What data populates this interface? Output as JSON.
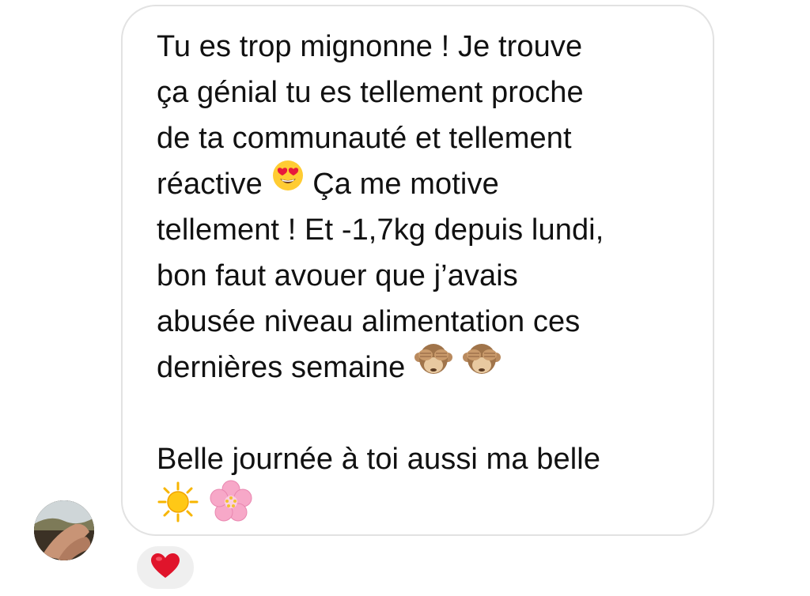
{
  "message": {
    "lines": [
      "Tu es trop mignonne ! Je trouve",
      "ça génial tu es tellement proche",
      "de ta communauté et tellement",
      "réactive",
      "Ça me motive",
      "tellement ! Et -1,7kg depuis lundi,",
      "bon faut avouer que j’avais",
      "abusée niveau alimentation ces",
      "dernières semaine",
      "Belle journée à toi aussi ma belle"
    ],
    "emojis": {
      "line4": "heart-eyes-emoji",
      "line9": [
        "see-no-evil-monkey-emoji",
        "see-no-evil-monkey-emoji"
      ],
      "line11": [
        "sun-emoji",
        "cherry-blossom-emoji"
      ]
    }
  },
  "reaction": {
    "icon": "red-heart-icon",
    "color": "#e0142b"
  },
  "colors": {
    "bubble_border": "#e2e2e2",
    "text": "#111111",
    "reaction_bg": "#efefef"
  }
}
